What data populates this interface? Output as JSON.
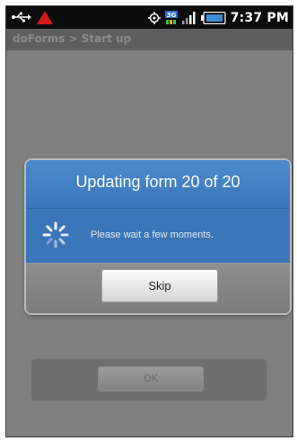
{
  "status_bar": {
    "left_icons": [
      "usb-icon",
      "warning-icon"
    ],
    "right_icons": [
      "gps-icon",
      "network-3g-icon",
      "signal-icon",
      "battery-icon"
    ],
    "time": "7:37 PM",
    "network_label": "3G",
    "colors": {
      "background": "#0c0c0c",
      "warning": "#d11a1a",
      "battery": "#3b8fd6"
    }
  },
  "app": {
    "title": "doForms > Start up"
  },
  "background": {
    "ok_button_label": "OK"
  },
  "dialog": {
    "title": "Updating form 20 of 20",
    "message": "Please wait a few moments.",
    "skip_button_label": "Skip",
    "spinner_icon": "loading-spinner-icon",
    "colors": {
      "accent": "#3a76b8",
      "title_text": "#ffffff"
    }
  }
}
